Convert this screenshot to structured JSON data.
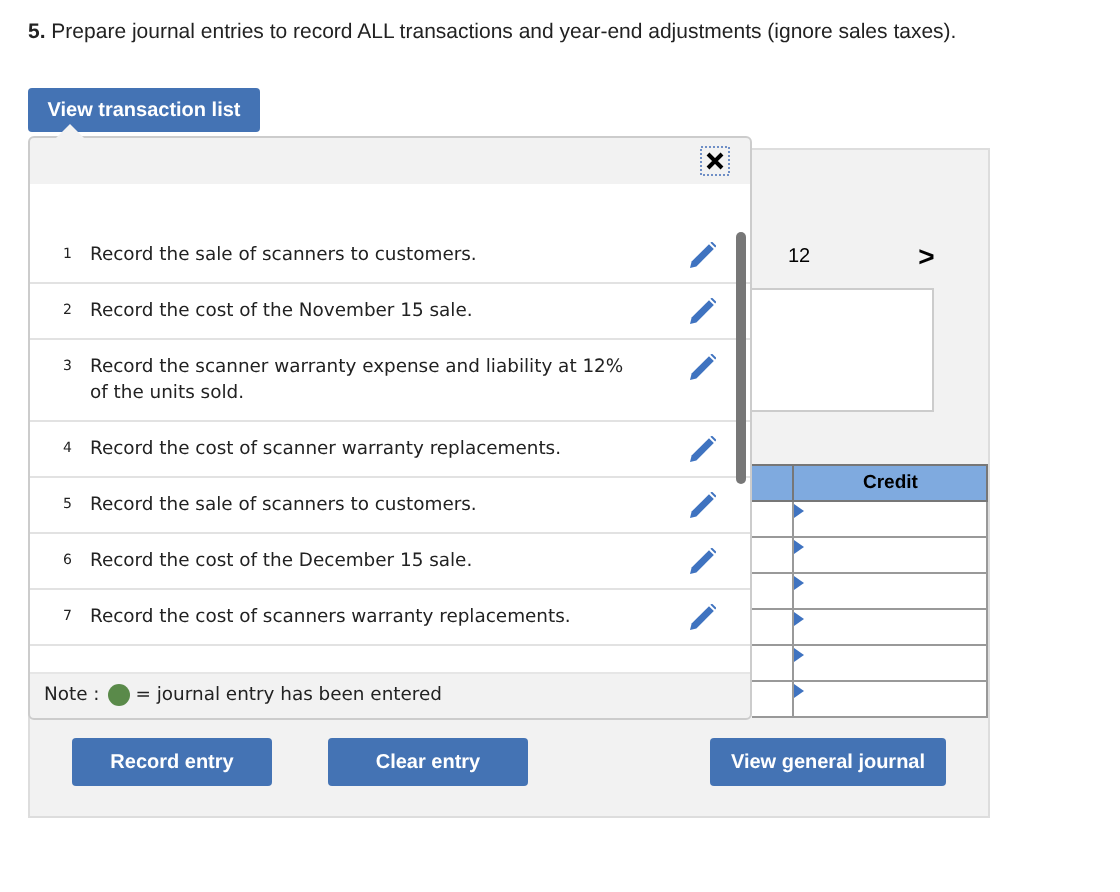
{
  "question": "**5.** Prepare journal entries to record ALL transactions and year-end adjustments (ignore sales taxes).",
  "view_list_button": "View transaction list",
  "transaction_list": [
    {
      "number": "1",
      "text": "Record the sale of scanners to customers."
    },
    {
      "number": "2",
      "text": "Record the cost of the November 15 sale."
    },
    {
      "number": "3",
      "text": "Record the scanner warranty expense and liability at 12% of the units sold."
    },
    {
      "number": "4",
      "text": "Record the cost of scanner warranty replacements."
    },
    {
      "number": "5",
      "text": "Record the sale of scanners to customers."
    },
    {
      "number": "6",
      "text": "Record the cost of the December 15 sale."
    },
    {
      "number": "7",
      "text": "Record the cost of scanners warranty replacements."
    }
  ],
  "note": {
    "prefix": "Note :",
    "color": "#5a8a4a",
    "text": "= journal entry has been entered"
  },
  "page": {
    "number": "12",
    "next": ">"
  },
  "journal_table": {
    "columns": [
      "Credit"
    ]
  },
  "buttons": [
    "Record entry",
    "Clear entry",
    "View general journal"
  ]
}
